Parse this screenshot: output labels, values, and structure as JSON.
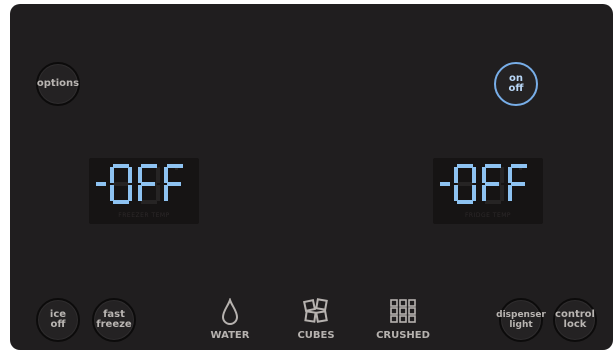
{
  "buttons": {
    "options": "options",
    "power": "on\noff",
    "ice_off": "ice\noff",
    "fast_freeze": "fast\nfreeze",
    "dispenser_light": "dispenser\nlight",
    "control_lock": "control\nlock"
  },
  "freezer": {
    "display": "-0F F",
    "label": "FREEZER TEMP"
  },
  "fridge": {
    "display": "-0F F",
    "label": "FRIDGE TEMP"
  },
  "dispenser": {
    "water": "WATER",
    "cubes": "CUBES",
    "crushed": "CRUSHED"
  },
  "colors": {
    "panel": "#201e1f",
    "lcd_segment_on": "#8ec3f2",
    "lcd_segment_off": "#262424",
    "power_ring": "#78aee8",
    "button_text": "#b9b5b2"
  }
}
